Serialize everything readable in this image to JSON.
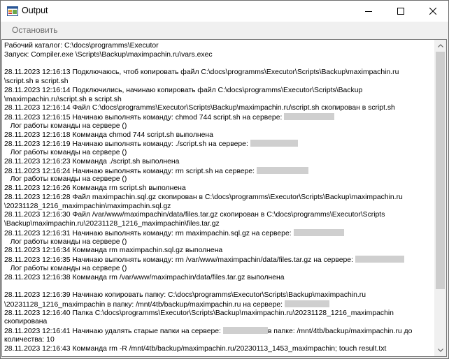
{
  "window": {
    "title": "Output"
  },
  "toolbar": {
    "stop_label": "Остановить"
  },
  "log": {
    "lines": [
      "Рабочий каталог: C:\\docs\\programms\\Executor",
      "Запуск: Compiler.exe \\Scripts\\Backup\\maximpachin.ru\\vars.exec",
      "",
      "28.11.2023 12:16:13 Подключаюсь, чтоб копировать файл C:\\docs\\programms\\Executor\\Scripts\\Backup\\maximpachin.ru",
      "\\script.sh в script.sh",
      "28.11.2023 12:16:14 Подключились, начинаю копировать файл C:\\docs\\programms\\Executor\\Scripts\\Backup",
      "\\maximpachin.ru\\script.sh в script.sh",
      "28.11.2023 12:16:14 Файл C:\\docs\\programms\\Executor\\Scripts\\Backup\\maximpachin.ru\\script.sh скопирован в script.sh",
      "28.11.2023 12:16:15 Начинаю выполнять команду: chmod 744 script.sh на сервере: [MASK:72]",
      "   Лог работы команды на сервере ()",
      "28.11.2023 12:16:18 Комманда chmod 744 script.sh выполнена",
      "28.11.2023 12:16:19 Начинаю выполнять команду: ./script.sh на сервере: [MASK:68]",
      "   Лог работы команды на сервере ()",
      "28.11.2023 12:16:23 Комманда ./script.sh выполнена",
      "28.11.2023 12:16:24 Начинаю выполнять команду: rm script.sh на сервере: [MASK:74]",
      "   Лог работы команды на сервере ()",
      "28.11.2023 12:16:26 Комманда rm script.sh выполнена",
      "28.11.2023 12:16:28 Файл maximpachin.sql.gz скопирован в C:\\docs\\programms\\Executor\\Scripts\\Backup\\maximpachin.ru",
      "\\20231128_1216_maximpachin\\maximpachin.sql.gz",
      "28.11.2023 12:16:30 Файл /var/www/maximpachin/data/files.tar.gz скопирован в C:\\docs\\programms\\Executor\\Scripts",
      "\\Backup\\maximpachin.ru\\20231128_1216_maximpachin\\files.tar.gz",
      "28.11.2023 12:16:31 Начинаю выполнять команду: rm maximpachin.sql.gz на сервере: [MASK:72]",
      "   Лог работы команды на сервере ()",
      "28.11.2023 12:16:34 Комманда rm maximpachin.sql.gz выполнена",
      "28.11.2023 12:16:35 Начинаю выполнять команду: rm /var/www/maximpachin/data/files.tar.gz на сервере: [MASK:70]",
      "   Лог работы команды на сервере ()",
      "28.11.2023 12:16:38 Комманда rm /var/www/maximpachin/data/files.tar.gz выполнена",
      "",
      "28.11.2023 12:16:39 Начинаю копировать папку: C:\\docs\\programms\\Executor\\Scripts\\Backup\\maximpachin.ru",
      "\\20231128_1216_maximpachin в папку: /mnt/4tb/backup/maximpachin.ru на сервере: [MASK:64]",
      "28.11.2023 12:16:40 Папка C:\\docs\\programms\\Executor\\Scripts\\Backup\\maximpachin.ru\\20231128_1216_maximpachin",
      "скопирована",
      "28.11.2023 12:16:41 Начинаю удалять старые папки на сервере: [MASK:64]в папке: /mnt/4tb/backup/maximpachin.ru до",
      "количества: 10",
      "28.11.2023 12:16:43 Комманда rm -R /mnt/4tb/backup/maximpachin.ru/20230113_1453_maximpachin; touch result.txt"
    ]
  },
  "icons": {
    "app": "app-window-icon",
    "minimize": "minimize-icon",
    "maximize": "maximize-icon",
    "close": "close-icon",
    "scroll_up": "scroll-up-arrow-icon",
    "scroll_down": "scroll-down-arrow-icon"
  },
  "colors": {
    "titlebar": "#ffffff",
    "background": "#f0f0f0",
    "disabled_text": "#6d6d6d"
  }
}
